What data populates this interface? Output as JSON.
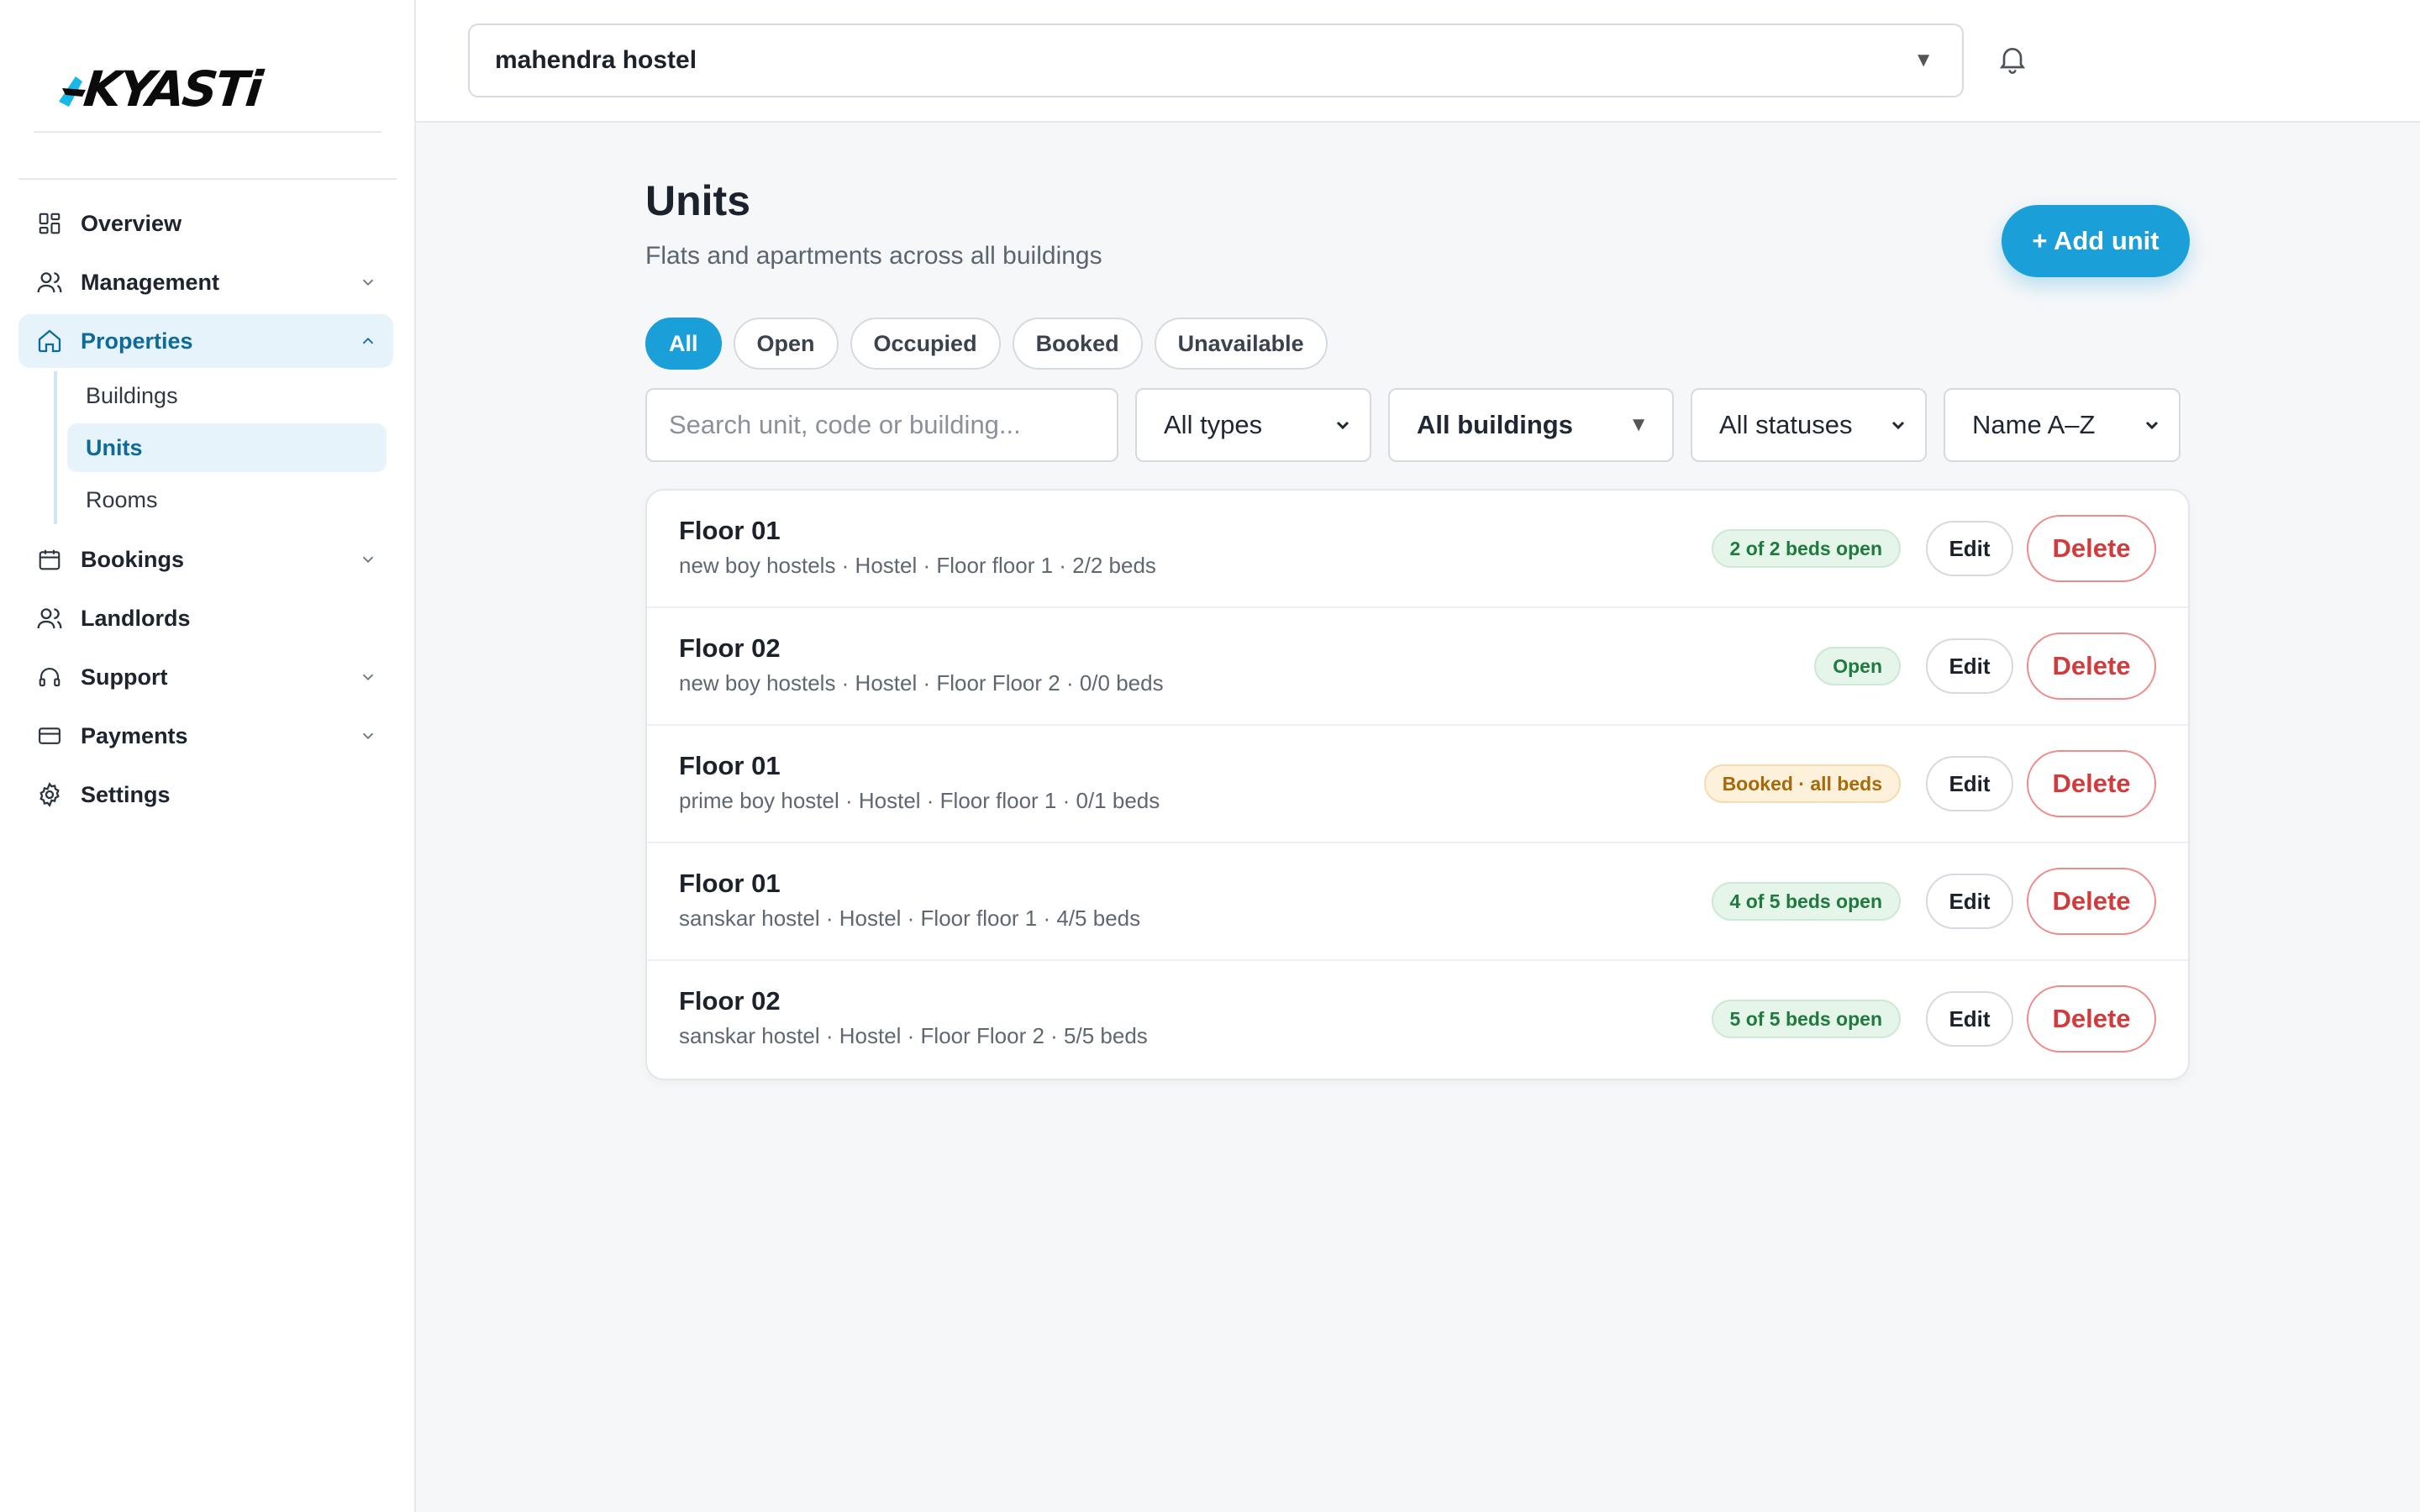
{
  "brand": {
    "logo_text": "KYASTi",
    "accent": "#1a9fd8",
    "logo_accent": "#18b8e8"
  },
  "sidebar": {
    "items": [
      {
        "label": "Overview",
        "icon": "grid-icon",
        "expandable": false
      },
      {
        "label": "Management",
        "icon": "users-icon",
        "expandable": true
      },
      {
        "label": "Properties",
        "icon": "home-icon",
        "expandable": true,
        "expanded": true,
        "active": true,
        "children": [
          {
            "label": "Buildings"
          },
          {
            "label": "Units",
            "active": true
          },
          {
            "label": "Rooms"
          }
        ]
      },
      {
        "label": "Bookings",
        "icon": "calendar-icon",
        "expandable": true
      },
      {
        "label": "Landlords",
        "icon": "users-icon",
        "expandable": false
      },
      {
        "label": "Support",
        "icon": "headset-icon",
        "expandable": true
      },
      {
        "label": "Payments",
        "icon": "card-icon",
        "expandable": true
      },
      {
        "label": "Settings",
        "icon": "gear-icon",
        "expandable": false
      }
    ]
  },
  "topbar": {
    "org_select": {
      "value": "mahendra hostel"
    },
    "notifications_icon": "bell-icon"
  },
  "page": {
    "title": "Units",
    "subtitle": "Flats and apartments across all buildings",
    "add_button": "+ Add unit"
  },
  "chips": [
    "All",
    "Open",
    "Occupied",
    "Booked",
    "Unavailable"
  ],
  "active_chip": "All",
  "filters": {
    "search_placeholder": "Search unit, code or building...",
    "type": "All types",
    "building": "All buildings",
    "status": "All statuses",
    "sort": "Name A–Z"
  },
  "units": [
    {
      "name": "Floor 01",
      "meta": "new boy hostels · Hostel · Floor floor 1 · 2/2 beds",
      "badge": "2 of 2 beds open",
      "badge_tone": "green",
      "edit": "Edit",
      "delete": "Delete"
    },
    {
      "name": "Floor 02",
      "meta": "new boy hostels · Hostel · Floor Floor 2 · 0/0 beds",
      "badge": "Open",
      "badge_tone": "green",
      "edit": "Edit",
      "delete": "Delete"
    },
    {
      "name": "Floor 01",
      "meta": "prime boy hostel · Hostel · Floor floor 1 · 0/1 beds",
      "badge": "Booked · all beds",
      "badge_tone": "amber",
      "edit": "Edit",
      "delete": "Delete"
    },
    {
      "name": "Floor 01",
      "meta": "sanskar hostel · Hostel · Floor floor 1 · 4/5 beds",
      "badge": "4 of 5 beds open",
      "badge_tone": "green",
      "edit": "Edit",
      "delete": "Delete"
    },
    {
      "name": "Floor 02",
      "meta": "sanskar hostel · Hostel · Floor Floor 2 · 5/5 beds",
      "badge": "5 of 5 beds open",
      "badge_tone": "green",
      "edit": "Edit",
      "delete": "Delete"
    }
  ]
}
